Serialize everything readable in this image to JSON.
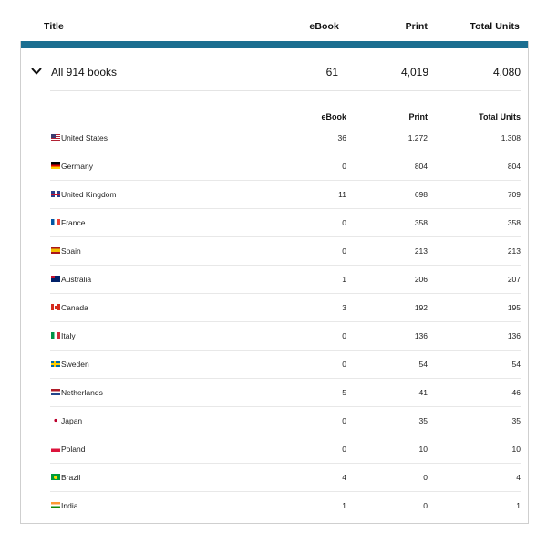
{
  "header": {
    "title": "Title",
    "ebook": "eBook",
    "print": "Print",
    "total": "Total Units"
  },
  "summary": {
    "label": "All 914 books",
    "ebook": "61",
    "print": "4,019",
    "total": "4,080",
    "expanded_icon": "chevron-down-icon"
  },
  "breakdown": {
    "columns": {
      "ebook": "eBook",
      "print": "Print",
      "total": "Total Units"
    },
    "rows": [
      {
        "flag": "us",
        "country": "United States",
        "ebook": "36",
        "print": "1,272",
        "total": "1,308"
      },
      {
        "flag": "de",
        "country": "Germany",
        "ebook": "0",
        "print": "804",
        "total": "804"
      },
      {
        "flag": "uk",
        "country": "United Kingdom",
        "ebook": "11",
        "print": "698",
        "total": "709"
      },
      {
        "flag": "fr",
        "country": "France",
        "ebook": "0",
        "print": "358",
        "total": "358"
      },
      {
        "flag": "es",
        "country": "Spain",
        "ebook": "0",
        "print": "213",
        "total": "213"
      },
      {
        "flag": "au",
        "country": "Australia",
        "ebook": "1",
        "print": "206",
        "total": "207"
      },
      {
        "flag": "ca",
        "country": "Canada",
        "ebook": "3",
        "print": "192",
        "total": "195"
      },
      {
        "flag": "it",
        "country": "Italy",
        "ebook": "0",
        "print": "136",
        "total": "136"
      },
      {
        "flag": "se",
        "country": "Sweden",
        "ebook": "0",
        "print": "54",
        "total": "54"
      },
      {
        "flag": "nl",
        "country": "Netherlands",
        "ebook": "5",
        "print": "41",
        "total": "46"
      },
      {
        "flag": "jp",
        "country": "Japan",
        "ebook": "0",
        "print": "35",
        "total": "35"
      },
      {
        "flag": "pl",
        "country": "Poland",
        "ebook": "0",
        "print": "10",
        "total": "10"
      },
      {
        "flag": "br",
        "country": "Brazil",
        "ebook": "4",
        "print": "0",
        "total": "4"
      },
      {
        "flag": "in",
        "country": "India",
        "ebook": "1",
        "print": "0",
        "total": "1"
      }
    ]
  },
  "colors": {
    "accent": "#1b6e90",
    "divider": "#e8e8e8"
  }
}
